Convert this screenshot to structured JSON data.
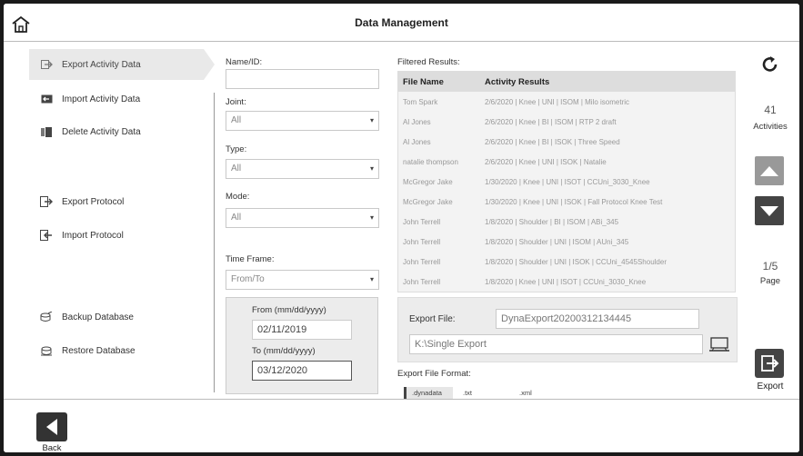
{
  "header": {
    "title": "Data Management"
  },
  "sidebar": {
    "items": [
      {
        "label": "Export Activity Data"
      },
      {
        "label": "Import Activity Data"
      },
      {
        "label": "Delete Activity Data"
      },
      {
        "label": "Export Protocol"
      },
      {
        "label": "Import Protocol"
      },
      {
        "label": "Backup Database"
      },
      {
        "label": "Restore Database"
      }
    ]
  },
  "filters": {
    "name_label": "Name/ID:",
    "name_value": "",
    "joint_label": "Joint:",
    "joint_value": "All",
    "type_label": "Type:",
    "type_value": "All",
    "mode_label": "Mode:",
    "mode_value": "All",
    "timeframe_label": "Time Frame:",
    "timeframe_value": "From/To",
    "from_label": "From (mm/dd/yyyy)",
    "from_value": "02/11/2019",
    "to_label": "To (mm/dd/yyyy)",
    "to_value": "03/12/2020"
  },
  "results": {
    "label": "Filtered Results:",
    "col_file": "File Name",
    "col_activity": "Activity Results",
    "rows": [
      {
        "file": "Tom Spark",
        "activity": "2/6/2020 | Knee | UNI | ISOM | Milo isometric"
      },
      {
        "file": "Al Jones",
        "activity": "2/6/2020 | Knee | BI | ISOM | RTP 2 draft"
      },
      {
        "file": "Al Jones",
        "activity": "2/6/2020 | Knee | BI | ISOK | Three Speed"
      },
      {
        "file": "natalie thompson",
        "activity": "2/6/2020 | Knee | UNI | ISOK | Natalie"
      },
      {
        "file": "McGregor Jake",
        "activity": "1/30/2020 | Knee | UNI | ISOT | CCUni_3030_Knee"
      },
      {
        "file": "McGregor Jake",
        "activity": "1/30/2020 | Knee | UNI | ISOK | Fall Protocol Knee Test"
      },
      {
        "file": "John Terrell",
        "activity": "1/8/2020 | Shoulder | BI | ISOM | ABi_345"
      },
      {
        "file": "John Terrell",
        "activity": "1/8/2020 | Shoulder | UNI | ISOM | AUni_345"
      },
      {
        "file": "John Terrell",
        "activity": "1/8/2020 | Shoulder | UNI | ISOK | CCUni_4545Shoulder"
      },
      {
        "file": "John Terrell",
        "activity": "1/8/2020 | Knee | UNI | ISOT | CCUni_3030_Knee"
      }
    ]
  },
  "export": {
    "file_label": "Export File:",
    "file_value": "DynaExport20200312134445",
    "path_value": "K:\\Single Export",
    "format_label": "Export File Format:",
    "formats": [
      ".dynadata",
      ".txt",
      ".xml"
    ],
    "button_label": "Export"
  },
  "stats": {
    "activities_count": "41",
    "activities_label": "Activities",
    "page_value": "1/5",
    "page_label": "Page"
  },
  "footer": {
    "back_label": "Back"
  }
}
